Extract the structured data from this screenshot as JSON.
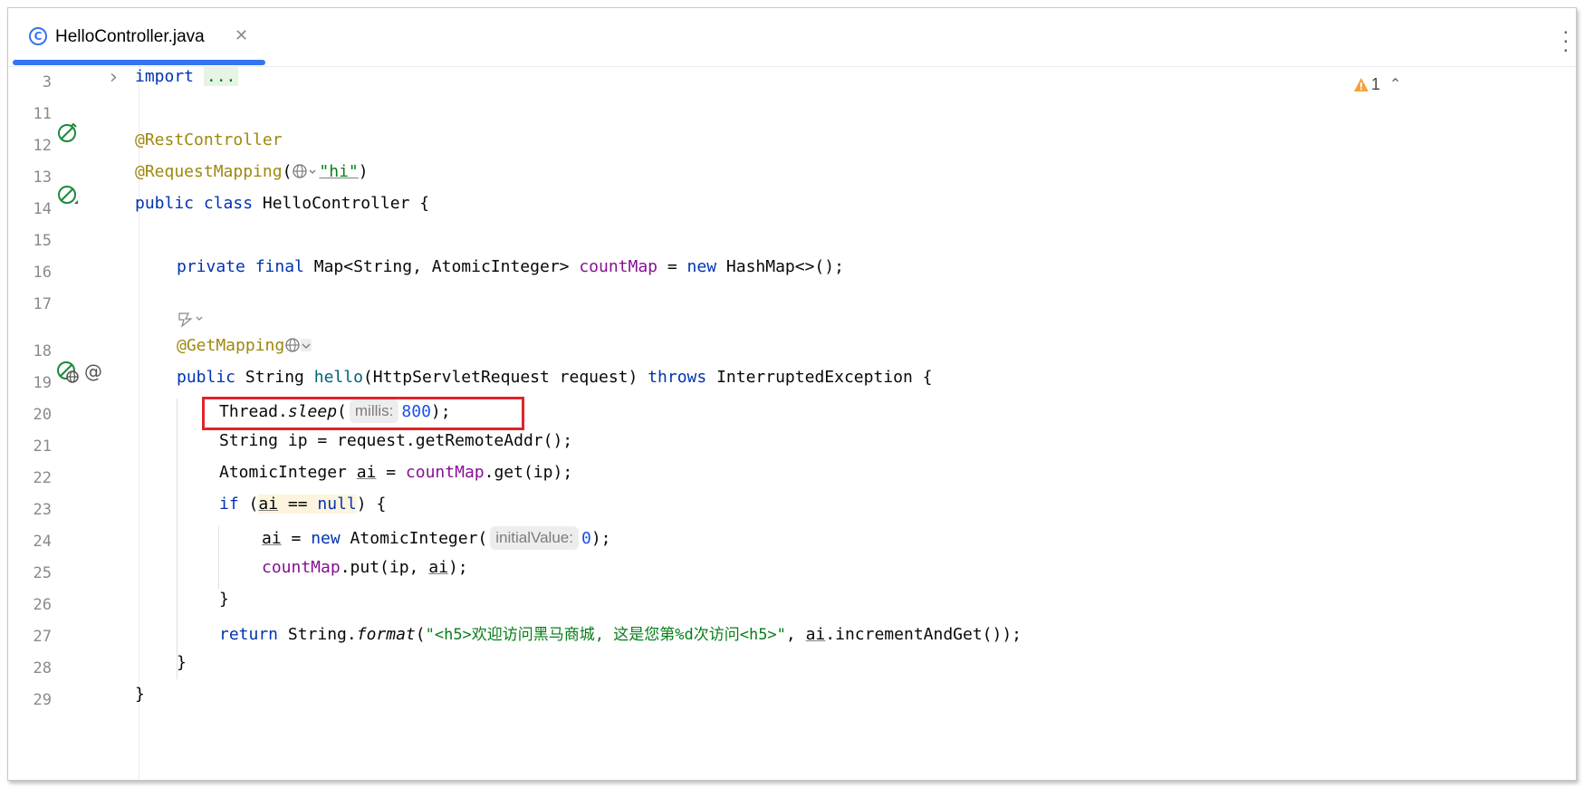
{
  "tab": {
    "title": "HelloController.java",
    "icon": "class-icon",
    "accent": "#3574f0"
  },
  "inspections": {
    "warning_count": "1"
  },
  "line_numbers": [
    "3",
    "11",
    "12",
    "13",
    "14",
    "15",
    "16",
    "17",
    "18",
    "19",
    "20",
    "21",
    "22",
    "23",
    "24",
    "25",
    "26",
    "27",
    "28",
    "29"
  ],
  "code": {
    "l3_import": "import",
    "l3_folded": "...",
    "l12": "@RestController",
    "l13_ann": "@RequestMapping",
    "l13_open": "(",
    "l13_str": "\"hi\"",
    "l13_close": ")",
    "l14_mod": "public class",
    "l14_rest": " HelloController {",
    "l16_mods": "private final",
    "l16_type": " Map<String, AtomicInteger> ",
    "l16_field": "countMap",
    "l16_eq": " = ",
    "l16_new": "new",
    "l16_rest": " HashMap<>();",
    "l18": "@GetMapping",
    "l19_pub": "public",
    "l19_ret": " String ",
    "l19_name": "hello",
    "l19_params": "(HttpServletRequest request) ",
    "l19_throws": "throws",
    "l19_rest": " InterruptedException {",
    "l20_a": "Thread.",
    "l20_m": "sleep",
    "l20_b": "(",
    "l20_hint": "millis:",
    "l20_num": "800",
    "l20_c": ");",
    "l21": "String ip = request.getRemoteAddr();",
    "l22_a": "AtomicInteger ",
    "l22_var": "ai",
    "l22_b": " = ",
    "l22_field": "countMap",
    "l22_c": ".get(ip);",
    "l23_if": "if",
    "l23_a": " (",
    "l23_var": "ai",
    "l23_eq": " == ",
    "l23_null": "null",
    "l23_b": ") {",
    "l24_var": "ai",
    "l24_a": " = ",
    "l24_new": "new",
    "l24_b": " AtomicInteger(",
    "l24_hint": "initialValue:",
    "l24_num": "0",
    "l24_c": ");",
    "l25_field": "countMap",
    "l25_a": ".put(ip, ",
    "l25_var": "ai",
    "l25_b": ");",
    "l26": "}",
    "l27_ret": "return",
    "l27_a": " String.",
    "l27_m": "format",
    "l27_b": "(",
    "l27_str": "\"<h5>欢迎访问黑马商城, 这是您第%d次访问<h5>\"",
    "l27_c": ", ",
    "l27_var": "ai",
    "l27_d": ".incrementAndGet());",
    "l28": "}",
    "l29": "}"
  }
}
